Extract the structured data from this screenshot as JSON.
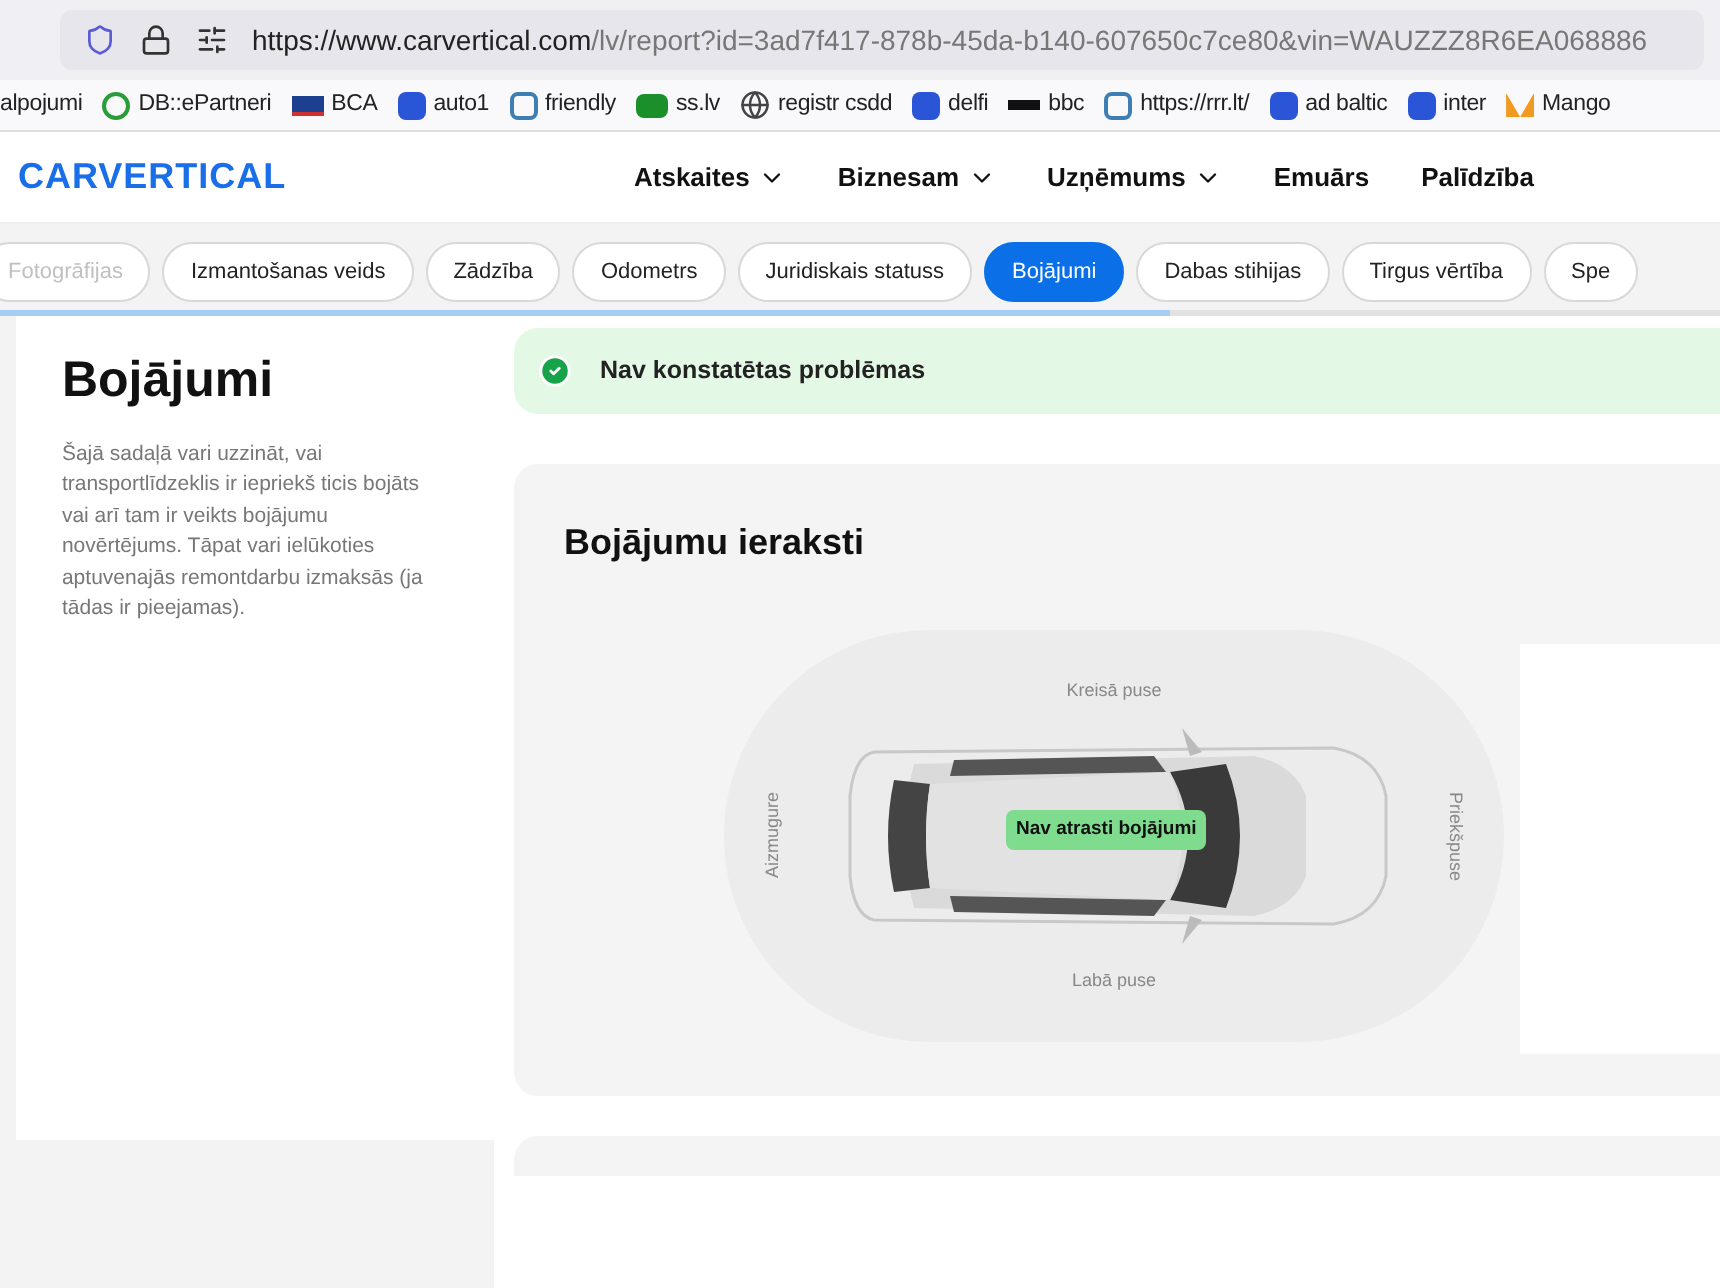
{
  "browser": {
    "url_host": "https://www.carvertical.com",
    "url_path": "/lv/report?id=3ad7f417-878b-45da-b140-607650c7ce80&vin=WAUZZZ8R6EA068886",
    "bookmarks": [
      {
        "label": "alpojumi",
        "kind": "none"
      },
      {
        "label": "DB::ePartneri",
        "kind": "circle"
      },
      {
        "label": "BCA",
        "kind": "flag"
      },
      {
        "label": "auto1",
        "kind": "tile"
      },
      {
        "label": "friendly",
        "kind": "pin"
      },
      {
        "label": "ss.lv",
        "kind": "ss"
      },
      {
        "label": "registr csdd",
        "kind": "globe"
      },
      {
        "label": "delfi",
        "kind": "tile"
      },
      {
        "label": "bbc",
        "kind": "dots"
      },
      {
        "label": "https://rrr.lt/",
        "kind": "pin"
      },
      {
        "label": "ad baltic",
        "kind": "tile"
      },
      {
        "label": "inter",
        "kind": "tile"
      },
      {
        "label": "Mango",
        "kind": "mango"
      }
    ]
  },
  "site": {
    "logo": "CARVERTICAL",
    "nav": [
      {
        "label": "Atskaites",
        "dropdown": true
      },
      {
        "label": "Biznesam",
        "dropdown": true
      },
      {
        "label": "Uzņēmums",
        "dropdown": true
      },
      {
        "label": "Emuārs",
        "dropdown": false
      },
      {
        "label": "Palīdzība",
        "dropdown": false
      }
    ]
  },
  "tabs": [
    {
      "label": "Fotogrāfijas",
      "selected": false,
      "faded": true
    },
    {
      "label": "Izmantošanas veids",
      "selected": false,
      "faded": false
    },
    {
      "label": "Zādzība",
      "selected": false,
      "faded": false
    },
    {
      "label": "Odometrs",
      "selected": false,
      "faded": false
    },
    {
      "label": "Juridiskais statuss",
      "selected": false,
      "faded": false
    },
    {
      "label": "Bojājumi",
      "selected": true,
      "faded": false
    },
    {
      "label": "Dabas stihijas",
      "selected": false,
      "faded": false
    },
    {
      "label": "Tirgus vērtība",
      "selected": false,
      "faded": false
    },
    {
      "label": "Spe",
      "selected": false,
      "faded": false
    }
  ],
  "tab_scroll": {
    "level": 0.68
  },
  "section": {
    "title": "Bojājumi",
    "description": "Šajā sadaļā vari uzzināt, vai transportlīdzeklis ir iepriekš ticis bojāts vai arī tam ir veikts bojājumu novērtējums. Tāpat vari ielūkoties aptuvenajās remontdarbu izmaksās (ja tādas ir pieejamas)."
  },
  "alert": {
    "text": "Nav konstatētas problēmas"
  },
  "records": {
    "title": "Bojājumu ieraksti",
    "top": "Kreisā puse",
    "bottom": "Labā puse",
    "left": "Aizmugure",
    "right": "Priekšpuse",
    "badge": "Nav atrasti bojājumi"
  }
}
